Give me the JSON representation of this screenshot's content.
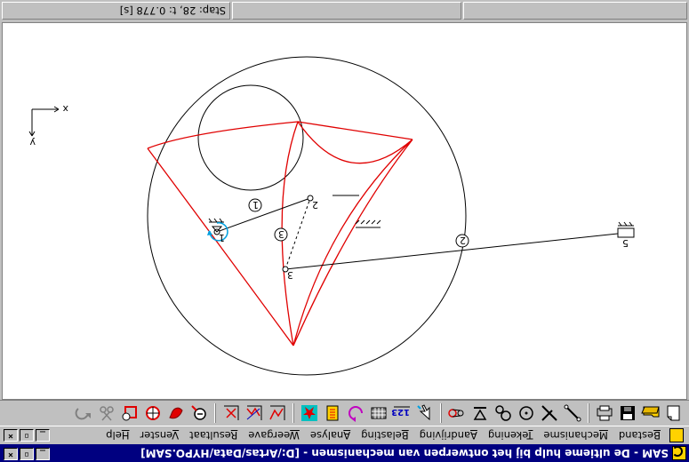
{
  "window": {
    "title": "SAM - De ultieme hulp bij het ontwerpen van mechanismen - [D:/Artas/Data/HYPO.SAM]",
    "minimize_glyph": "_",
    "restore_glyph": "▫",
    "close_glyph": "×"
  },
  "menu": {
    "items": [
      "Bestand",
      "Mechanisme",
      "Tekening",
      "Aandrijving",
      "Belasting",
      "Analyse",
      "Weergave",
      "Resultaat",
      "Venster",
      "Help"
    ]
  },
  "toolbar": {
    "buttons": [
      {
        "icon": "new-document-icon"
      },
      {
        "icon": "open-folder-icon"
      },
      {
        "icon": "save-disk-icon"
      },
      {
        "icon": "print-icon"
      },
      {
        "icon": "bar-element-icon"
      },
      {
        "icon": "slider-element-icon"
      },
      {
        "icon": "hinge-element-icon"
      },
      {
        "icon": "gear-pair-icon"
      },
      {
        "icon": "support-icon"
      },
      {
        "icon": "belt-icon"
      },
      {
        "icon": "select-pointer-icon"
      },
      {
        "icon": "numbering-icon",
        "text": "123"
      },
      {
        "icon": "grid-icon"
      },
      {
        "icon": "rotate-drive-icon"
      },
      {
        "icon": "load-icon"
      },
      {
        "icon": "star-icon"
      },
      {
        "icon": "graph-x-icon"
      },
      {
        "icon": "graph-xy-icon"
      },
      {
        "icon": "graph-cross-icon"
      },
      {
        "icon": "zoom-out-icon"
      },
      {
        "icon": "pan-icon"
      },
      {
        "icon": "zoom-target-icon"
      },
      {
        "icon": "zoom-window-icon"
      },
      {
        "icon": "scissors-icon"
      },
      {
        "icon": "undo-icon"
      }
    ]
  },
  "drawing": {
    "axis_x": "x",
    "axis_y": "y",
    "node_labels": [
      "1",
      "2",
      "3",
      "5"
    ],
    "element_numbers": [
      "1",
      "2",
      "3"
    ],
    "colors": {
      "curve": "#e00000",
      "lines": "#000000",
      "drive_arrow": "#00a0e0"
    }
  },
  "status": {
    "panel1": "",
    "panel2": "",
    "panel3": "Stap: 28, t: 0.778 [s]"
  }
}
